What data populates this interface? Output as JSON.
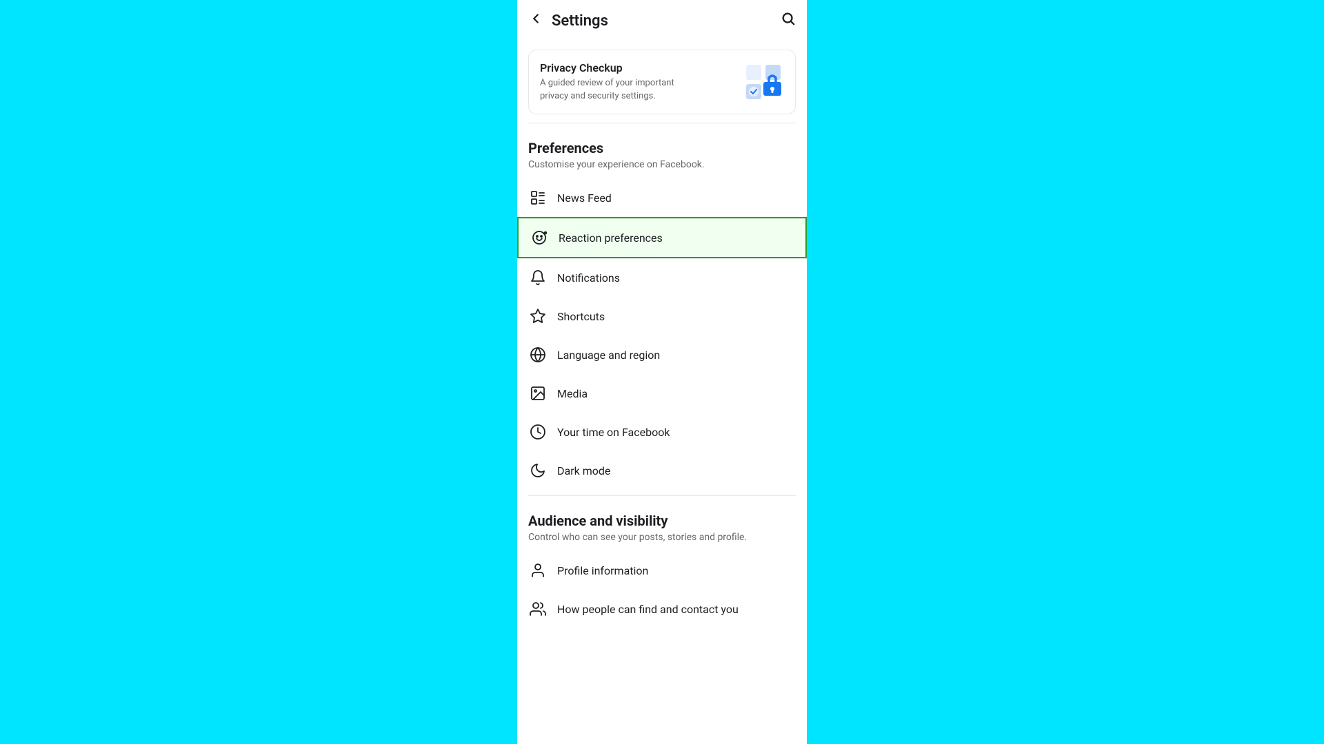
{
  "header": {
    "title": "Settings",
    "back_label": "←",
    "search_label": "🔍"
  },
  "privacy_card": {
    "title": "Privacy Checkup",
    "description": "A guided review of your important privacy and security settings."
  },
  "preferences": {
    "section_title": "Preferences",
    "section_desc": "Customise your experience on Facebook.",
    "items": [
      {
        "id": "news-feed",
        "label": "News Feed",
        "active": false
      },
      {
        "id": "reaction-preferences",
        "label": "Reaction preferences",
        "active": true
      },
      {
        "id": "notifications",
        "label": "Notifications",
        "active": false
      },
      {
        "id": "shortcuts",
        "label": "Shortcuts",
        "active": false
      },
      {
        "id": "language-and-region",
        "label": "Language and region",
        "active": false
      },
      {
        "id": "media",
        "label": "Media",
        "active": false
      },
      {
        "id": "your-time-on-facebook",
        "label": "Your time on Facebook",
        "active": false
      },
      {
        "id": "dark-mode",
        "label": "Dark mode",
        "active": false
      }
    ]
  },
  "audience": {
    "section_title": "Audience and visibility",
    "section_desc": "Control who can see your posts, stories and profile.",
    "items": [
      {
        "id": "profile-information",
        "label": "Profile information",
        "active": false
      },
      {
        "id": "how-people-find",
        "label": "How people can find and contact you",
        "active": false
      }
    ]
  }
}
